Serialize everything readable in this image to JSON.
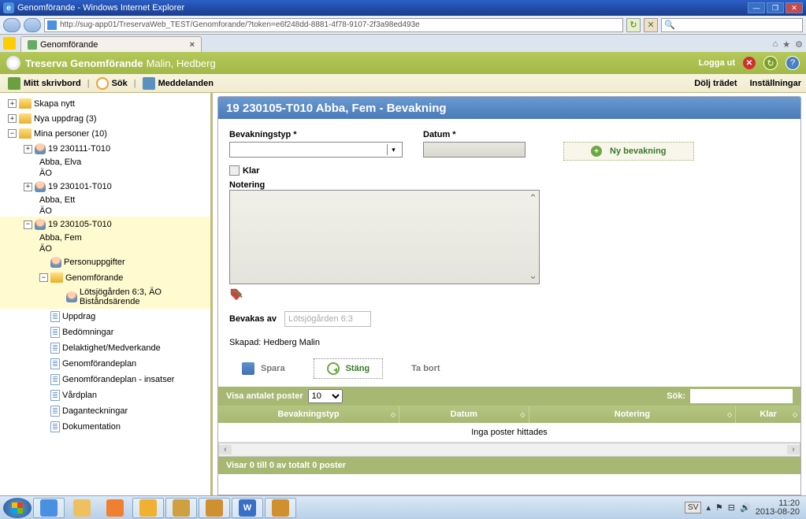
{
  "window": {
    "title": "Genomförande - Windows Internet Explorer"
  },
  "address": {
    "url": "http://sug-app01/TreservaWeb_TEST/Genomforande/?token=e6f248dd-8881-4f78-9107-2f3a98ed493e"
  },
  "browser_tab": {
    "label": "Genomförande"
  },
  "app": {
    "product": "Treserva Genomförande",
    "user": "Malin, Hedberg",
    "logout": "Logga ut"
  },
  "toolbar": {
    "desktop": "Mitt skrivbord",
    "search": "Sök",
    "messages": "Meddelanden",
    "hide_tree": "Dölj trädet",
    "settings": "Inställningar"
  },
  "tree": {
    "skapa": "Skapa nytt",
    "nya_uppdrag": "Nya uppdrag (3)",
    "mina_personer": "Mina personer (10)",
    "p1": {
      "id": "19 230111-T010",
      "name": "Abba, Elva",
      "unit": "ÄO"
    },
    "p2": {
      "id": "19 230101-T010",
      "name": "Abba, Ett",
      "unit": "ÄO"
    },
    "p3": {
      "id": "19 230105-T010",
      "name": "Abba, Fem",
      "unit": "ÄO"
    },
    "personuppgifter": "Personuppgifter",
    "genomforande": "Genomförande",
    "sub_genomforande": "Lötsjögården 6:3, ÄO Biståndsärende",
    "uppdrag": "Uppdrag",
    "bedomningar": "Bedömningar",
    "delaktighet": "Delaktighet/Medverkande",
    "genomplan": "Genomförandeplan",
    "genomplan_insatser": "Genomförandeplan - insatser",
    "vardplan": "Vårdplan",
    "daganteckningar": "Daganteckningar",
    "dokumentation": "Dokumentation"
  },
  "page": {
    "title": "19 230105-T010 Abba, Fem - Bevakning"
  },
  "form": {
    "bevakningstyp_label": "Bevakningstyp *",
    "datum_label": "Datum *",
    "klar_label": "Klar",
    "notering_label": "Notering",
    "ny_bevakning": "Ny bevakning",
    "bevakas_av_label": "Bevakas av",
    "bevakas_av_value": "Lötsjögården 6:3",
    "skapad": "Skapad: Hedberg Malin",
    "spara": "Spara",
    "stang": "Stäng",
    "tabort": "Ta bort"
  },
  "grid": {
    "visa_poster": "Visa antalet poster",
    "page_size": "10",
    "sok_label": "Sök:",
    "col_typ": "Bevakningstyp",
    "col_datum": "Datum",
    "col_notering": "Notering",
    "col_klar": "Klar",
    "empty": "Inga poster hittades",
    "footer": "Visar 0 till 0 av totalt 0 poster",
    "sok_value": ""
  },
  "systray": {
    "lang": "SV",
    "time": "11:20",
    "date": "2013-08-20"
  }
}
